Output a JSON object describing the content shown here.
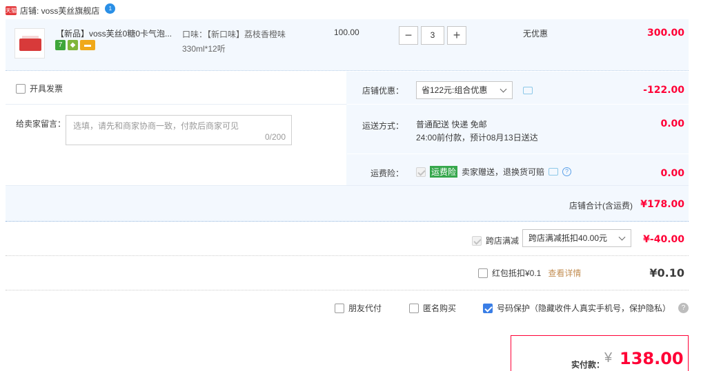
{
  "shop": {
    "badge": "天猫",
    "name": "店铺: voss芙丝旗舰店",
    "chat_badge": "1"
  },
  "item": {
    "title": "【新品】voss芙丝0糖0卡气泡...",
    "sku": "口味：【新口味】荔枝香橙味330ml*12听",
    "unit_price": "100.00",
    "quantity": "3",
    "qty_minus": "−",
    "qty_plus": "+",
    "promotion": "无优惠",
    "subtotal": "300.00",
    "service_icons": [
      "seven-day-return-icon",
      "shield-icon",
      "credit-card-icon"
    ]
  },
  "options": {
    "invoice_label": "开具发票",
    "message_label": "给卖家留言：",
    "message_placeholder": "选填，请先和商家协商一致，付款后商家可见",
    "message_counter": "0/200"
  },
  "discount": {
    "label": "店铺优惠：",
    "selected": "省122元:组合优惠",
    "amount": "-122.00"
  },
  "shipping": {
    "label": "运送方式：",
    "line1": "普通配送 快递 免邮",
    "line2": "24:00前付款，预计08月13日送达",
    "amount": "0.00"
  },
  "insurance": {
    "label": "运费险：",
    "tag": "运费险",
    "text": "卖家赠送，退换货可赔",
    "amount": "0.00"
  },
  "shop_total": {
    "label": "店铺合计(含运费)",
    "amount": "¥178.00"
  },
  "cross_store": {
    "label": "跨店满减",
    "selected": "跨店满减抵扣40.00元",
    "amount": "¥-40.00"
  },
  "red_packet": {
    "label": "红包抵扣¥0.1",
    "link": "查看详情",
    "amount": "¥0.10"
  },
  "protections": {
    "friend_pay": "朋友代付",
    "anonymous": "匿名购买",
    "number_protect": "号码保护（隐藏收件人真实手机号，保护隐私）",
    "help": "?"
  },
  "payment": {
    "label": "实付款：",
    "currency": "¥",
    "amount": "138.00"
  },
  "colors": {
    "accent_red": "#ff0036",
    "row_bg": "#f3f8fe",
    "checkbox_blue": "#3a7ee6"
  }
}
